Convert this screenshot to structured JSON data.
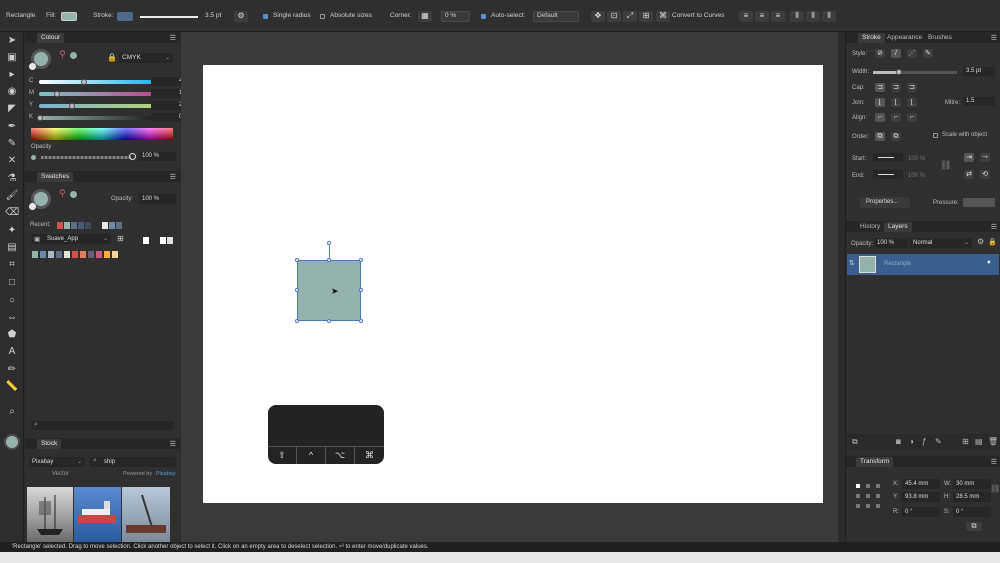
{
  "toolbar": {
    "tool_name": "Rectangle",
    "fill_label": "Fill:",
    "stroke_label": "Stroke:",
    "stroke_width": "3.5 pt",
    "single_radius": "Single radius",
    "absolute_sizes": "Absolute sizes",
    "corner_label": "Corner:",
    "corner_value": "0 %",
    "auto_select_label": "Auto-select:",
    "auto_select_value": "Default",
    "convert_label": "Convert to Curves",
    "fill_color": "#95b3ad",
    "stroke_color": "#4d6a8a"
  },
  "colour_panel": {
    "title": "Colour",
    "model": "CMYK",
    "sliders": [
      {
        "label": "C",
        "value": "46"
      },
      {
        "label": "M",
        "value": "16"
      },
      {
        "label": "Y",
        "value": "29"
      },
      {
        "label": "K",
        "value": "0"
      }
    ],
    "opacity_label": "Opacity",
    "opacity_value": "100 %"
  },
  "swatches_panel": {
    "title": "Swatches",
    "opacity_label": "Opacity:",
    "opacity_value": "100 %",
    "recent_label": "Recent:",
    "palette_name": "Suave_App",
    "recent_colors": [
      "#d0504a",
      "#95b3ad",
      "#5d6f86",
      "#4b5a73",
      "#3c4a5e"
    ],
    "palette_colors": [
      "#95b3ad",
      "#6f8aa8",
      "#a8b8c4",
      "#5d6f86",
      "#e8e2d4",
      "#d0504a",
      "#e08060",
      "#6a5a7a",
      "#c85a7a",
      "#f0b040",
      "#f2d49a"
    ]
  },
  "stock_panel": {
    "title": "Stock",
    "source": "Pixabay",
    "query": "ship",
    "vector_tab": "Vector",
    "powered_by": "Powered by",
    "provider": "Pixabay"
  },
  "stroke_panel": {
    "tabs": [
      "Stroke",
      "Appearance",
      "Brushes"
    ],
    "style_label": "Style:",
    "width_label": "Width:",
    "width_value": "3.5 pt",
    "cap_label": "Cap:",
    "join_label": "Join:",
    "mitre_label": "Mitre:",
    "mitre_value": "1.5",
    "align_label": "Align:",
    "order_label": "Order:",
    "scale_with_object": "Scale with object",
    "start_label": "Start:",
    "end_label": "End:",
    "start_pct": "100 %",
    "end_pct": "100 %",
    "properties_label": "Properties...",
    "pressure_label": "Pressure:"
  },
  "layers_panel": {
    "tabs": [
      "History",
      "Layers"
    ],
    "opacity_label": "Opacity:",
    "opacity_value": "100 %",
    "blend_mode": "Normal",
    "layer_name": "Rectangle"
  },
  "transform_panel": {
    "title": "Transform",
    "x_label": "X:",
    "x_value": "45.4 mm",
    "y_label": "Y:",
    "y_value": "93.8 mm",
    "w_label": "W:",
    "w_value": "30 mm",
    "h_label": "H:",
    "h_value": "28.5 mm",
    "r_label": "R:",
    "r_value": "0 °",
    "s_label": "S:",
    "s_value": "0 °"
  },
  "keypad": {
    "keys": [
      "⇧",
      "^",
      "⌥",
      "⌘"
    ]
  },
  "status": {
    "text": "'Rectangle' selected. Drag to move selection. Click another object to select it. Click on an empty area to deselect selection. ⏎ to enter move/duplicate values."
  }
}
